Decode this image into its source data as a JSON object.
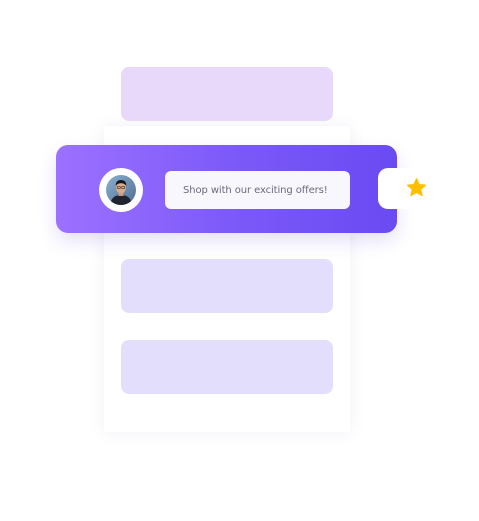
{
  "promo": {
    "message": "Shop with our exciting offers!"
  },
  "icons": {
    "avatar": "user-avatar-photo",
    "favorite": "star-icon"
  },
  "colors": {
    "banner_start": "#9c71ff",
    "banner_end": "#6a4bf2",
    "star": "#ffbf00",
    "placeholder_top": "#e8d9fb",
    "placeholder": "#e3defc"
  }
}
